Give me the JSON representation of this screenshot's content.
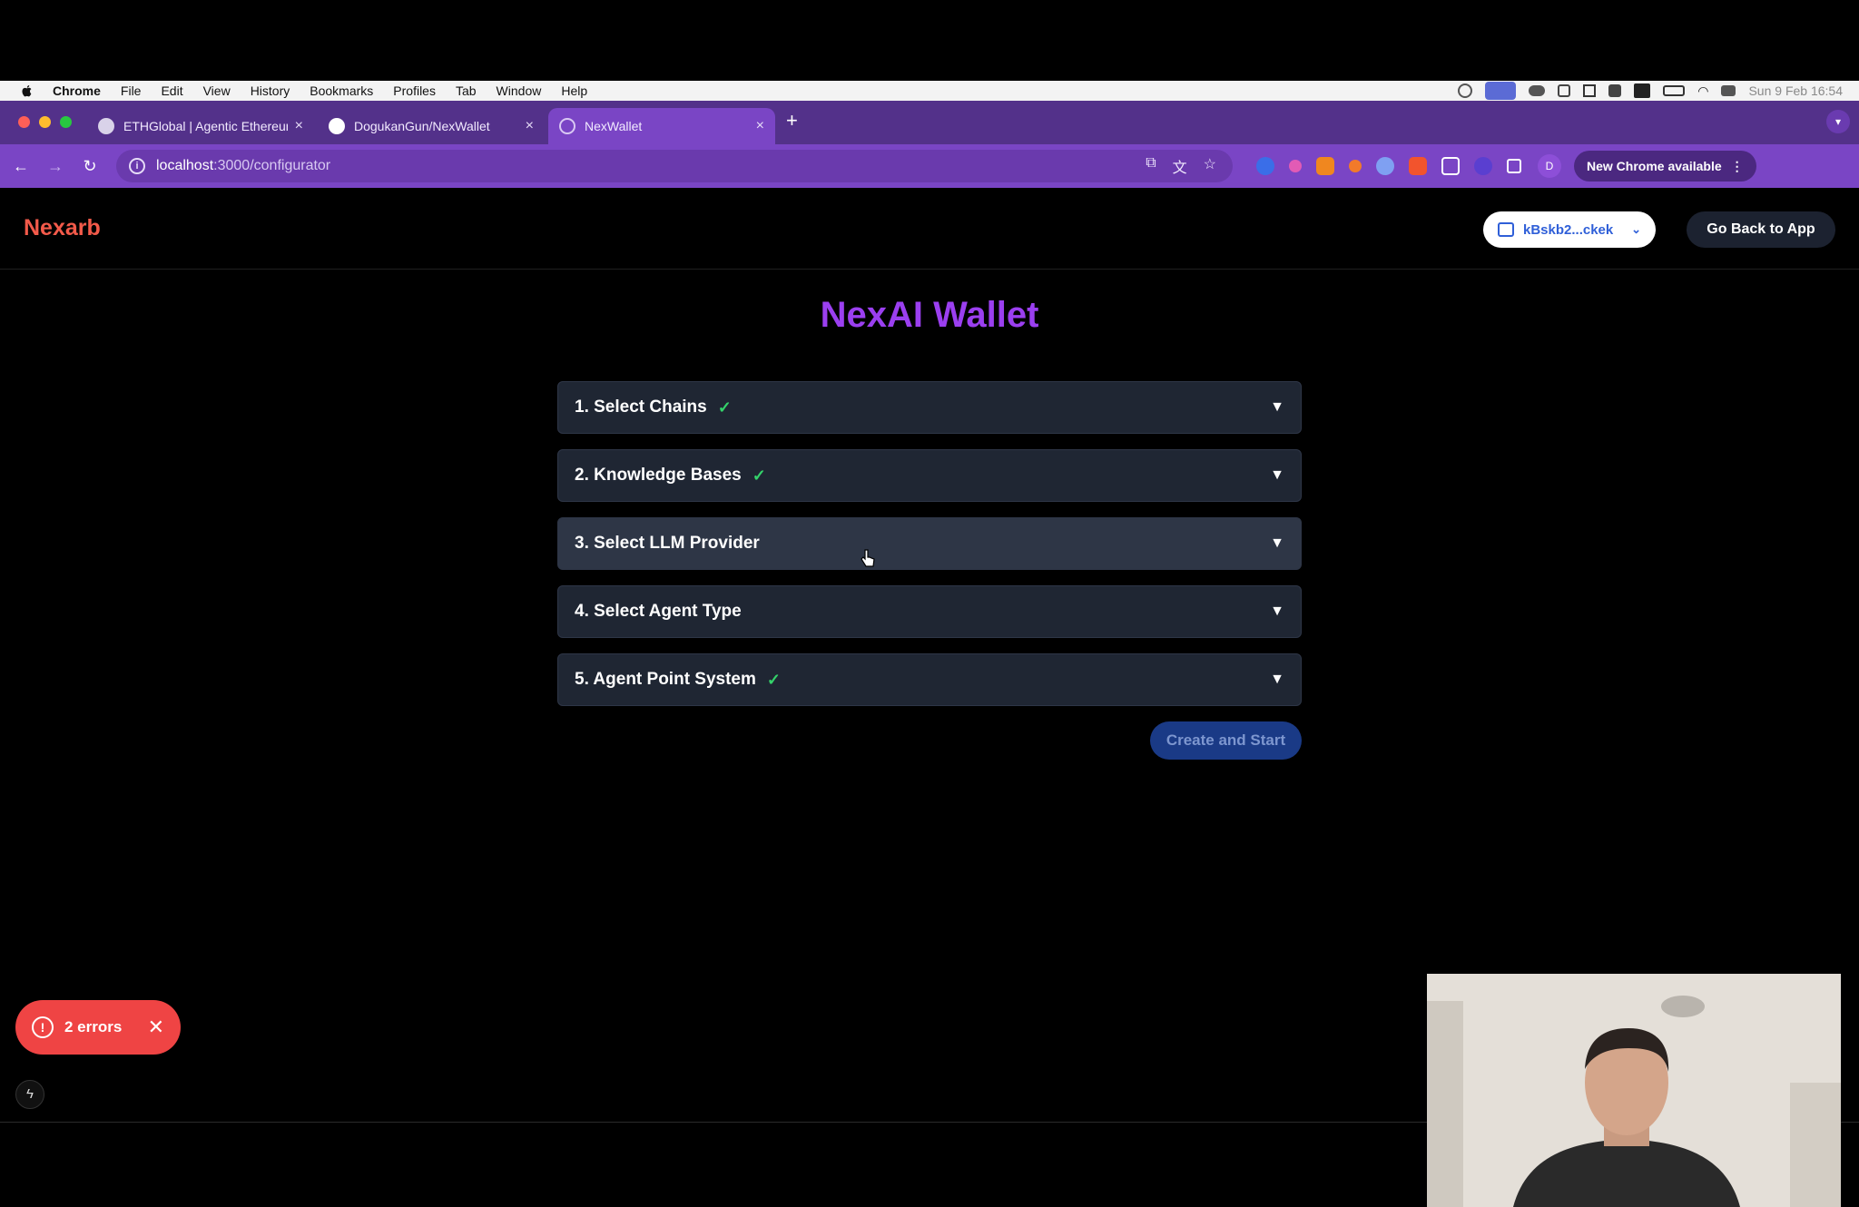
{
  "menubar": {
    "items": [
      "Chrome",
      "File",
      "Edit",
      "View",
      "History",
      "Bookmarks",
      "Profiles",
      "Tab",
      "Window",
      "Help"
    ],
    "datetime": "Sun 9 Feb  16:54"
  },
  "browser": {
    "tabs": [
      {
        "title": "ETHGlobal | Agentic Ethereum",
        "close": "×"
      },
      {
        "title": "DogukanGun/NexWallet",
        "close": "×"
      },
      {
        "title": "NexWallet",
        "close": "×"
      }
    ],
    "new_tab": "+",
    "url_host": "localhost",
    "url_path": ":3000/configurator",
    "profile_initial": "D",
    "new_chrome_label": "New Chrome available"
  },
  "app": {
    "logo": "Nexarb",
    "wallet_address": "kBskb2...ckek",
    "back_button": "Go Back to App",
    "page_title": "NexAI Wallet",
    "sections": [
      {
        "label": "1. Select Chains",
        "completed": true
      },
      {
        "label": "2. Knowledge Bases",
        "completed": true
      },
      {
        "label": "3. Select LLM Provider",
        "completed": false
      },
      {
        "label": "4. Select Agent Type",
        "completed": false
      },
      {
        "label": "5. Agent Point System",
        "completed": true
      }
    ],
    "check_glyph": "✓",
    "expand_glyph": "▼",
    "create_button": "Create and Start"
  },
  "devtools": {
    "errors_label": "2 errors"
  },
  "colors": {
    "tab_strip": "#53318a",
    "toolbar": "#7a45c5",
    "logo": "#f35a4a",
    "title": "#9b3ff0",
    "check": "#34d26a",
    "error_pill": "#ef4444",
    "create_button": "#1a3a86"
  }
}
